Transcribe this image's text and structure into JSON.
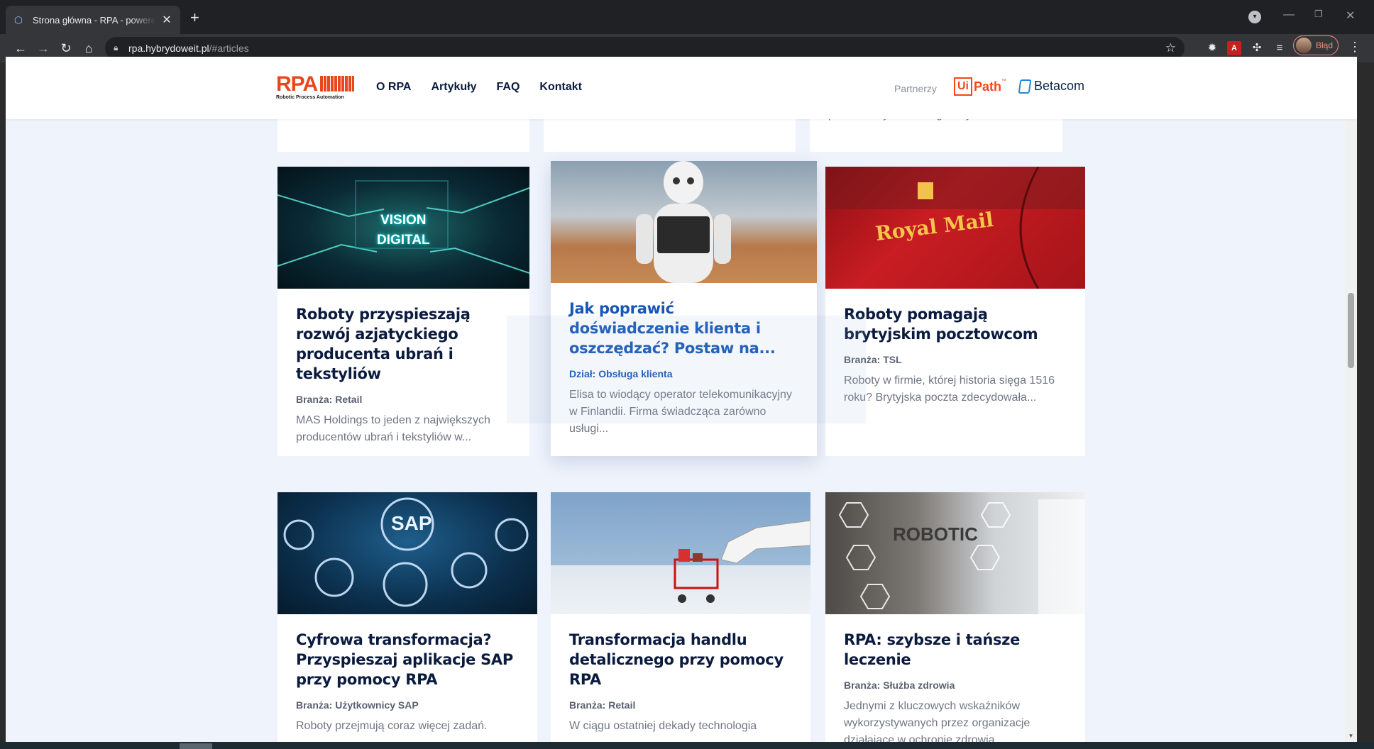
{
  "browser": {
    "tab_title": "Strona główna - RPA - powered by",
    "new_tab_icon": "plus-icon",
    "url_host": "rpa.hybrydoweit.pl",
    "url_path": "/#articles",
    "profile_status": "Błąd"
  },
  "header": {
    "logo_mark": "RPA",
    "logo_tagline": "Robotic Process Automation",
    "nav": [
      "O RPA",
      "Artykuły",
      "FAQ",
      "Kontakt"
    ],
    "partners_label": "Partnerzy",
    "uipath_ui": "Ui",
    "uipath_path": "Path",
    "uipath_tm": "™",
    "betacom": "Betacom"
  },
  "top_row_fragment": {
    "excerpt_right": "powtarzalnych, szczegółowych..."
  },
  "articles": [
    {
      "image_text": "VISION\nDIGITAL",
      "title": "Roboty przyspieszają rozwój azjatyckiego producenta ubrań i tekstyliów",
      "category": "Branża: Retail",
      "excerpt": "MAS Holdings to jeden z największych producentów ubrań i tekstyliów w..."
    },
    {
      "image_text": "",
      "title": "Jak poprawić doświadczenie klienta i oszczędzać? Postaw na...",
      "category": "Dział: Obsługa klienta",
      "excerpt": "Elisa to wiodący operator telekomunikacyjny w Finlandii. Firma świadcząca zarówno usługi..."
    },
    {
      "image_text": "Royal Mail",
      "title": "Roboty pomagają brytyjskim pocztowcom",
      "category": "Branża: TSL",
      "excerpt": "Roboty w firmie, której historia sięga 1516 roku? Brytyjska poczta zdecydowała..."
    },
    {
      "image_text": "SAP",
      "title": "Cyfrowa transformacja? Przyspieszaj aplikacje SAP przy pomocy RPA",
      "category": "Branża: Użytkownicy SAP",
      "excerpt": "Roboty przejmują coraz więcej zadań."
    },
    {
      "image_text": "",
      "title": "Transformacja handlu detalicznego przy pomocy RPA",
      "category": "Branża: Retail",
      "excerpt": "W ciągu ostatniej dekady technologia"
    },
    {
      "image_text": "ROBOTIC",
      "title": "RPA: szybsze i tańsze leczenie",
      "category": "Branża: Służba zdrowia",
      "excerpt": "Jednymi z kluczowych wskaźników wykorzystywanych przez organizacje działające w ochronie zdrowia..."
    }
  ],
  "colors": {
    "brand_orange": "#e8471d",
    "link_blue": "#1557b8",
    "title_navy": "#0b1b3f",
    "page_bg": "#eef3fc"
  }
}
